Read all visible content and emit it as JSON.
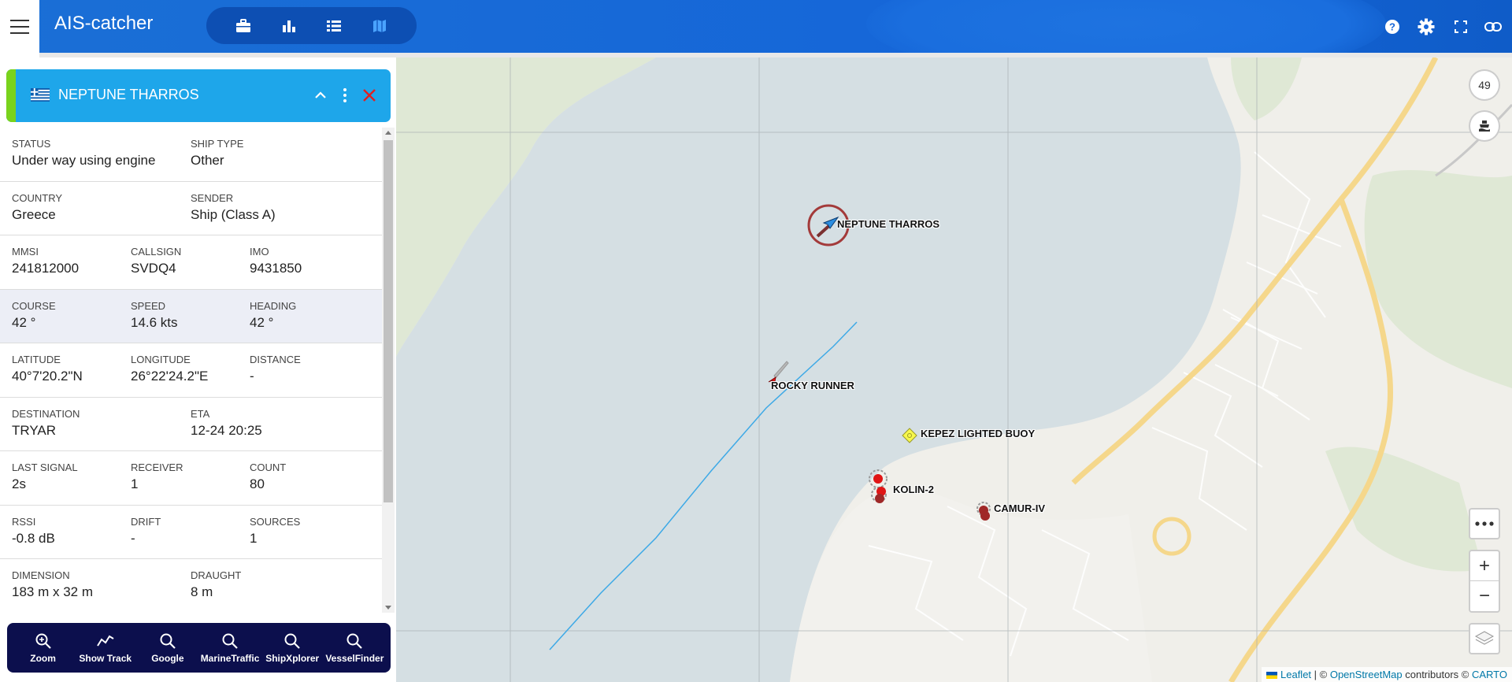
{
  "header": {
    "title": "AIS-catcher",
    "tabs": [
      {
        "icon": "briefcase-icon",
        "label": ""
      },
      {
        "icon": "bar-chart-icon",
        "label": ""
      },
      {
        "icon": "list-icon",
        "label": ""
      },
      {
        "icon": "map-icon",
        "label": ""
      }
    ],
    "right_icons": [
      "help-icon",
      "gear-icon",
      "fullscreen-icon",
      "link-icon"
    ]
  },
  "vessel": {
    "name": "NEPTUNE THARROS",
    "flag": "greece-flag",
    "accent_color": "#79d31c",
    "header_color": "#1ea6ea",
    "fields": {
      "status_label": "STATUS",
      "status": "Under way using engine",
      "shiptype_label": "SHIP TYPE",
      "shiptype": "Other",
      "country_label": "COUNTRY",
      "country": "Greece",
      "sender_label": "SENDER",
      "sender": "Ship (Class A)",
      "mmsi_label": "MMSI",
      "mmsi": "241812000",
      "callsign_label": "CALLSIGN",
      "callsign": "SVDQ4",
      "imo_label": "IMO",
      "imo": "9431850",
      "course_label": "COURSE",
      "course": "42 °",
      "speed_label": "SPEED",
      "speed": "14.6 kts",
      "heading_label": "HEADING",
      "heading": "42 °",
      "lat_label": "LATITUDE",
      "lat": "40°7'20.2\"N",
      "lon_label": "LONGITUDE",
      "lon": "26°22'24.2\"E",
      "distance_label": "DISTANCE",
      "distance": "-",
      "destination_label": "DESTINATION",
      "destination": "TRYAR",
      "eta_label": "ETA",
      "eta": "12-24 20:25",
      "lastsignal_label": "LAST SIGNAL",
      "lastsignal": "2s",
      "receiver_label": "RECEIVER",
      "receiver": "1",
      "count_label": "COUNT",
      "count": "80",
      "rssi_label": "RSSI",
      "rssi": "-0.8 dB",
      "drift_label": "DRIFT",
      "drift": "-",
      "sources_label": "SOURCES",
      "sources": "1",
      "dimension_label": "DIMENSION",
      "dimension": "183 m x 32 m",
      "draught_label": "DRAUGHT",
      "draught": "8 m"
    }
  },
  "toolbar": {
    "zoom": "Zoom",
    "track": "Show Track",
    "google": "Google",
    "marinetraffic": "MarineTraffic",
    "shipxplorer": "ShipXplorer",
    "vesselfinder": "VesselFinder"
  },
  "map": {
    "labels": {
      "neptune": "NEPTUNE THARROS",
      "rocky": "ROCKY RUNNER",
      "kepez": "KEPEZ LIGHTED BUOY",
      "kolin": "KOLIN-2",
      "camur": "CAMUR-IV"
    },
    "ship_count": "49",
    "zoom_in": "+",
    "zoom_out": "−",
    "attribution": {
      "leaflet": "Leaflet",
      "sep1": " | © ",
      "osm": "OpenStreetMap",
      "contrib": " contributors © ",
      "carto": "CARTO"
    }
  }
}
